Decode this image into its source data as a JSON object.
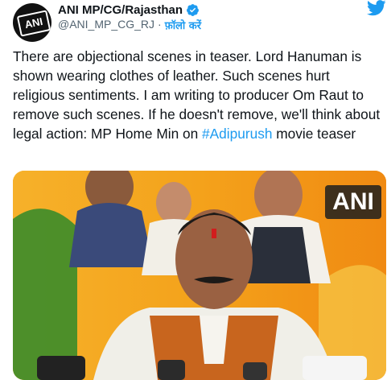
{
  "account": {
    "name": "ANI MP/CG/Rajasthan",
    "handle": "@ANI_MP_CG_RJ",
    "separator": "·",
    "follow_label": "फ़ॉलो करें",
    "avatar_text": "ANI",
    "verified": true
  },
  "tweet": {
    "text_before": "There are objectional scenes in teaser. Lord Hanuman is shown wearing clothes of leather. Such scenes hurt religious sentiments. I am writing to producer Om Raut to remove such scenes. If he doesn't remove, we'll think about legal action: MP Home Min on ",
    "hashtag": "#Adipurush",
    "text_after": " movie teaser"
  },
  "media": {
    "watermark": "ANI"
  },
  "colors": {
    "accent": "#1d9bf0",
    "text": "#0f1419",
    "secondary": "#536471"
  },
  "icons": {
    "brand": "twitter-bird-icon",
    "verified": "verified-badge-icon"
  }
}
